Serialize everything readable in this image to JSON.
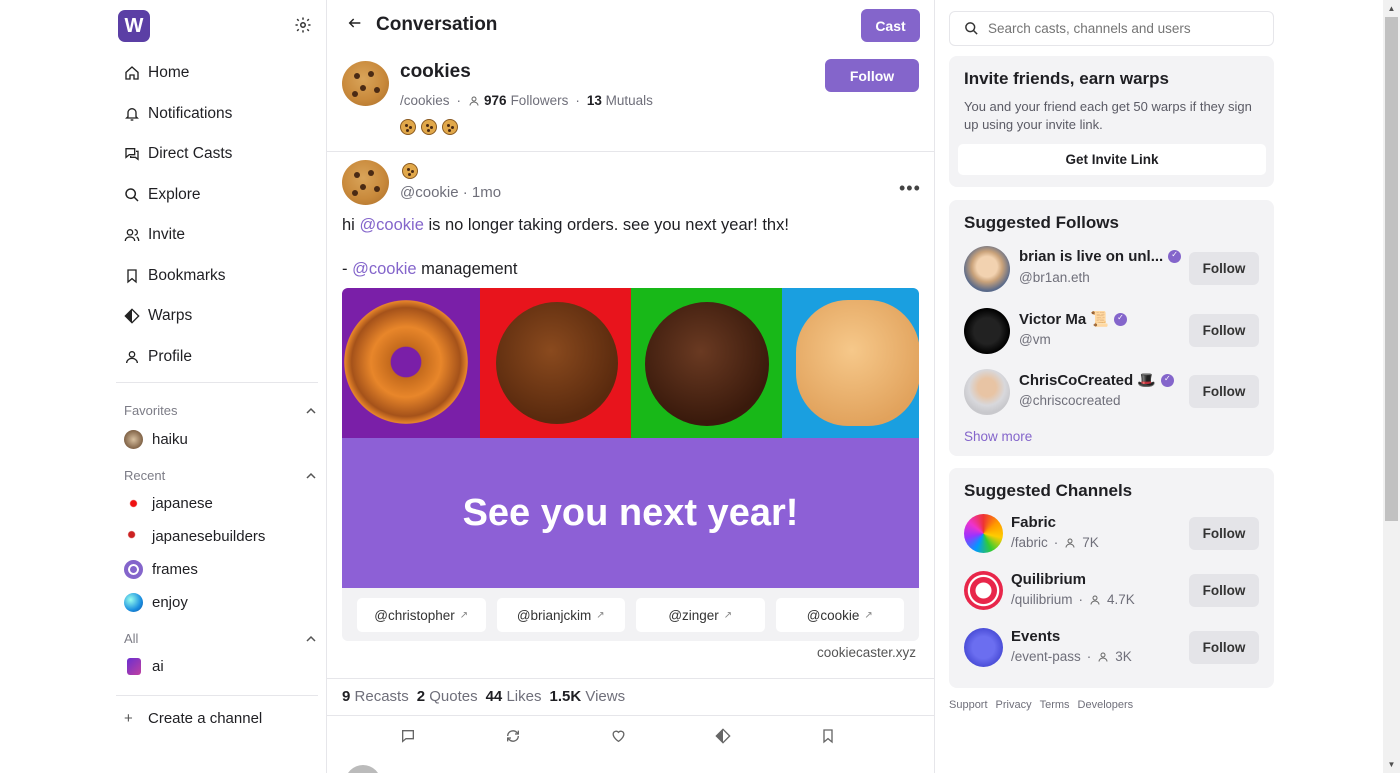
{
  "app": {
    "logo_letter": "W"
  },
  "nav": [
    {
      "label": "Home",
      "icon": "home-icon"
    },
    {
      "label": "Notifications",
      "icon": "bell-icon"
    },
    {
      "label": "Direct Casts",
      "icon": "chat-icon"
    },
    {
      "label": "Explore",
      "icon": "search-icon"
    },
    {
      "label": "Invite",
      "icon": "users-icon"
    },
    {
      "label": "Bookmarks",
      "icon": "bookmark-icon"
    },
    {
      "label": "Warps",
      "icon": "warp-icon"
    },
    {
      "label": "Profile",
      "icon": "user-icon"
    }
  ],
  "sections": {
    "favorites": {
      "title": "Favorites",
      "items": [
        "haiku"
      ]
    },
    "recent": {
      "title": "Recent",
      "items": [
        "japanese",
        "japanesebuilders",
        "frames",
        "enjoy"
      ]
    },
    "all": {
      "title": "All",
      "items": [
        "ai"
      ]
    }
  },
  "create_channel": "Create a channel",
  "header": {
    "title": "Conversation",
    "cast_label": "Cast"
  },
  "channel": {
    "name": "cookies",
    "path": "/cookies",
    "followers_count": "976",
    "followers_label": "Followers",
    "mutuals_count": "13",
    "mutuals_label": "Mutuals",
    "follow_label": "Follow"
  },
  "post": {
    "handle": "@cookie · 1mo",
    "line1_prefix": "hi ",
    "line1_mention": "@cookie",
    "line1_suffix": " is no longer taking orders. see you next year! thx!",
    "line2_prefix": "- ",
    "line2_mention": "@cookie",
    "line2_suffix": " management",
    "frame": {
      "banner_text": "See you next year!",
      "buttons": [
        "@christopher",
        "@brianjckim",
        "@zinger",
        "@cookie"
      ],
      "domain": "cookiecaster.xyz",
      "panel_colors": [
        "#7a1fa8",
        "#e8141c",
        "#18b818",
        "#1a9fe0"
      ]
    },
    "stats": {
      "recasts_count": "9",
      "recasts_label": "Recasts",
      "quotes_count": "2",
      "quotes_label": "Quotes",
      "likes_count": "44",
      "likes_label": "Likes",
      "views_count": "1.5K",
      "views_label": "Views"
    }
  },
  "search": {
    "placeholder": "Search casts, channels and users"
  },
  "invite": {
    "title": "Invite friends, earn warps",
    "description": "You and your friend each get 50 warps if they sign up using your invite link.",
    "button": "Get Invite Link"
  },
  "suggested_follows": {
    "title": "Suggested Follows",
    "users": [
      {
        "name": "brian is live on unl...",
        "handle": "@br1an.eth",
        "follow": "Follow"
      },
      {
        "name": "Victor Ma 📜",
        "handle": "@vm",
        "follow": "Follow"
      },
      {
        "name": "ChrisCoCreated 🎩",
        "handle": "@chriscocreated",
        "follow": "Follow"
      }
    ],
    "show_more": "Show more"
  },
  "suggested_channels": {
    "title": "Suggested Channels",
    "channels": [
      {
        "name": "Fabric",
        "path": "/fabric",
        "count": "7K",
        "follow": "Follow"
      },
      {
        "name": "Quilibrium",
        "path": "/quilibrium",
        "count": "4.7K",
        "follow": "Follow"
      },
      {
        "name": "Events",
        "path": "/event-pass",
        "count": "3K",
        "follow": "Follow"
      }
    ]
  },
  "footer": [
    "Support",
    "Privacy",
    "Terms",
    "Developers"
  ],
  "colors": {
    "accent": "#8465cb",
    "banner": "#8d60d6",
    "logo": "#5b3fa5"
  }
}
